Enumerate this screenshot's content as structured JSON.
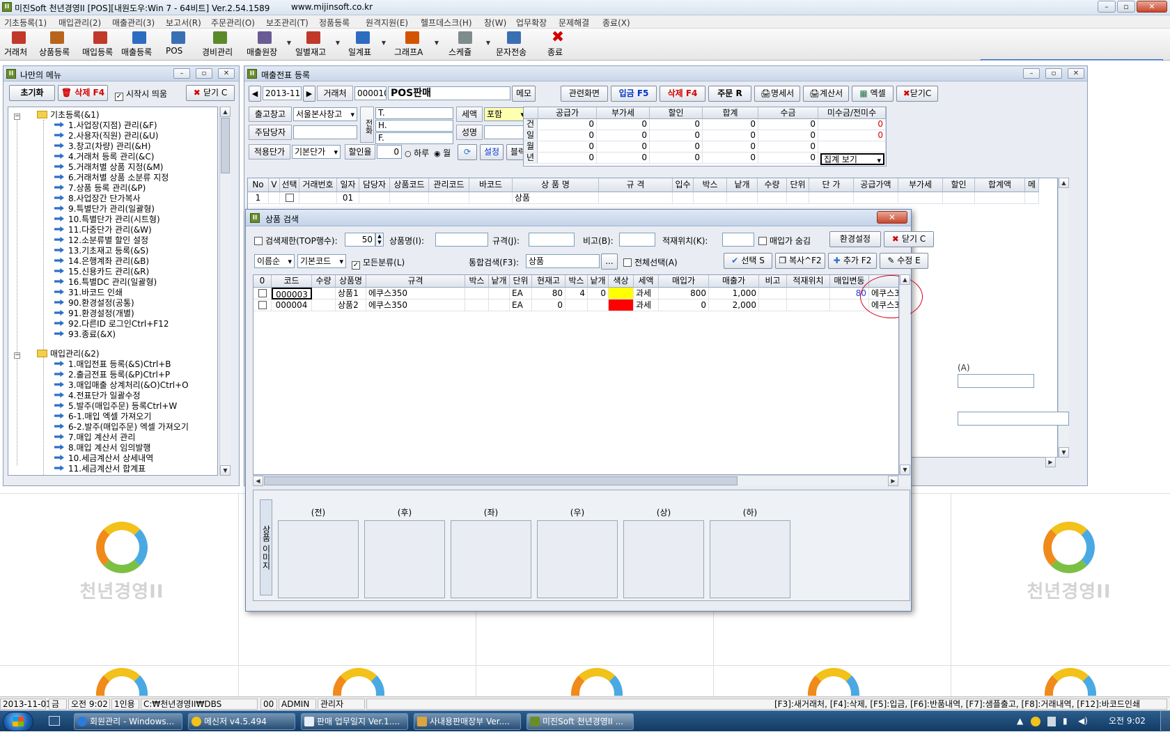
{
  "window": {
    "title": "미진Soft 천년경영II [POS][내원도우:Win 7 - 64비트] Ver.2.54.1589",
    "url": "www.mijinsoft.co.kr",
    "minimize": "–",
    "restore": "▫",
    "close": "✕"
  },
  "menu": [
    "기초등록(1)",
    "매입관리(2)",
    "매출관리(3)",
    "보고서(R)",
    "주문관리(O)",
    "보조관리(T)",
    "정품등록",
    "원격지원(E)",
    "헬프데스크(H)",
    "창(W)",
    "업무확장",
    "문제해결",
    "종료(X)"
  ],
  "toolbar": [
    {
      "label": "거래처",
      "icon": "client-icon",
      "color": "#c0392b"
    },
    {
      "label": "상품등록",
      "icon": "product-icon",
      "color": "#b8651b"
    },
    {
      "label": "매입등록",
      "icon": "purchase-icon",
      "color": "#c0392b"
    },
    {
      "label": "매출등록",
      "icon": "sales-icon",
      "color": "#2d6cc0"
    },
    {
      "label": "POS",
      "icon": "pos-icon",
      "color": "#3b6fb4"
    },
    {
      "label": "경비관리",
      "icon": "expense-icon",
      "color": "#5c8a2a"
    },
    {
      "label": "매출원장",
      "icon": "ledger-icon",
      "color": "#6b5b95"
    },
    {
      "label": "일별재고",
      "icon": "daily-stock-icon",
      "color": "#c0392b"
    },
    {
      "label": "일계표",
      "icon": "daily-report-icon",
      "color": "#2d6cc0"
    },
    {
      "label": "그래프A",
      "icon": "graph-icon",
      "color": "#d35400"
    },
    {
      "label": "스케쥴",
      "icon": "schedule-icon",
      "color": "#7f8c8d"
    },
    {
      "label": "문자전송",
      "icon": "sms-icon",
      "color": "#3b6fb4"
    },
    {
      "label": "종료",
      "icon": "exit-icon",
      "color": "#d40000"
    }
  ],
  "brand": {
    "name": "미진"
  },
  "mymenu": {
    "title": "나만의 메뉴",
    "reset": "초기화",
    "delete": "삭제 F4",
    "startup": "시작시 띄움",
    "close": "닫기 C",
    "sections": [
      {
        "label": "기초등록(&1)",
        "items": [
          "1.사업장(지점) 관리(&F)",
          "2.사용자(직원) 관리(&U)",
          "3.창고(차량) 관리(&H)",
          "4.거래처 등록 관리(&C)",
          "5.거래처별 상품 지정(&M)",
          "6.거래처별 상품 소분류 지정",
          "7.상품 등록 관리(&P)",
          "8.사업장간 단가복사",
          "9.특별단가 관리(일괄형)",
          "10.특별단가 관리(시트형)",
          "11.다중단가 관리(&W)",
          "12.소분류별 할인 설정",
          "13.기초재고 등록(&S)",
          "14.은행계좌 관리(&B)",
          "15.신용카드 관리(&R)",
          "16.특별DC 관리(일괄형)",
          "31.바코드 인쇄",
          "90.환경설정(공통)",
          "91.환경설정(개별)",
          "92.다른ID 로그인Ctrl+F12",
          "93.종료(&X)"
        ]
      },
      {
        "label": "매입관리(&2)",
        "items": [
          "1.매입전표 등록(&S)Ctrl+B",
          "2.출금전표 등록(&P)Ctrl+P",
          "3.매입매출 상계처리(&O)Ctrl+O",
          "4.전표단가 일괄수정",
          "5.발주(매입주문) 등록Ctrl+W",
          "6-1.매입 엑셀 가져오기",
          "6-2.발주(매입주문) 엑셀 가져오기",
          "7.매입 계산서 관리",
          "8.매입 계산서 임의발행",
          "10.세금계산서 상세내역",
          "11.세금계산서 합계표"
        ]
      }
    ]
  },
  "sales": {
    "title": "매출전표 등록",
    "date": "2013-11",
    "client_label": "거래처",
    "client_code": "000010",
    "client_name": "POS판매",
    "memo": "메모",
    "buttons": {
      "related": "관련화면",
      "deposit": "입금 F5",
      "delete": "삭제 F4",
      "order": "주문 R",
      "statement": "명세서",
      "invoice": "계산서",
      "excel": "엑셀",
      "close": "닫기C"
    },
    "warehouse_label": "출고창고",
    "warehouse": "서울본사창고",
    "manager_label": "주담당자",
    "phone_label": "전화",
    "phone_t": "T.",
    "phone_h": "H.",
    "phone_f": "F.",
    "tax_label": "세액",
    "tax_value": "포함",
    "name_label": "성명",
    "price_label": "적용단가",
    "price_value": "기본단가",
    "discount_label": "할인율",
    "discount_value": "0",
    "daily": "하루",
    "monthly": "월",
    "settings": "설정",
    "block": "블럭",
    "summary": {
      "headers": [
        "공급가",
        "부가세",
        "할인",
        "합계",
        "수금",
        "미수금/전미수"
      ],
      "rows": [
        {
          "label": "건",
          "values": [
            "0",
            "0",
            "0",
            "0",
            "0",
            "0"
          ]
        },
        {
          "label": "일",
          "values": [
            "0",
            "0",
            "0",
            "0",
            "0",
            "0"
          ]
        },
        {
          "label": "월",
          "values": [
            "0",
            "0",
            "0",
            "0",
            "0",
            ""
          ]
        },
        {
          "label": "년",
          "values": [
            "0",
            "0",
            "0",
            "0",
            "0",
            ""
          ]
        }
      ],
      "view": "집계 보기"
    },
    "grid": {
      "headers": [
        "No",
        "V",
        "선택",
        "거래번호",
        "일자",
        "담당자",
        "상품코드",
        "관리코드",
        "바코드",
        "상 품 명",
        "규 격",
        "입수",
        "박스",
        "낱개",
        "수량",
        "단위",
        "단 가",
        "공급가액",
        "부가세",
        "할인",
        "합계액",
        "메"
      ],
      "row": {
        "no": "1",
        "day": "01",
        "name": "상품"
      }
    },
    "side_label": "(A)"
  },
  "dialog": {
    "title": "상품 검색",
    "close": "✕",
    "limit_label": "검색제한(TOP행수):",
    "limit_value": "50",
    "name_label": "상품명(I):",
    "spec_label": "규격(J):",
    "note_label": "비고(B):",
    "location_label": "적재위치(K):",
    "hide_cost": "매입가 숨김",
    "env": "환경설정",
    "close_btn": "닫기 C",
    "sort": "이름순",
    "code_sort": "기본코드",
    "all_class": "모든분류(L)",
    "search_label": "통합검색(F3):",
    "search_value": "상품",
    "browse": "...",
    "select_all": "전체선택(A)",
    "select": "선택 S",
    "copy": "복사^F2",
    "add": "추가 F2",
    "edit": "수정 E",
    "headers": [
      "0",
      "코드",
      "수량",
      "상품명",
      "규격",
      "박스",
      "낱개",
      "단위",
      "현재고",
      "박스",
      "낱개",
      "색상",
      "세액",
      "매입가",
      "매출가",
      "비고",
      "적재위치",
      "매입변동",
      ""
    ],
    "rows": [
      {
        "code": "000003",
        "qty": "",
        "name": "상품1",
        "spec": "에쿠스350",
        "box": "",
        "each": "",
        "unit": "EA",
        "stock": "80",
        "box2": "4",
        "each2": "0",
        "color": "#ffff00",
        "tax": "과세",
        "cost": "800",
        "price": "1,000",
        "note": "",
        "loc": "",
        "change": "80",
        "extra": "에쿠스3"
      },
      {
        "code": "000004",
        "qty": "",
        "name": "상품2",
        "spec": "에쿠스350",
        "box": "",
        "each": "",
        "unit": "EA",
        "stock": "0",
        "box2": "",
        "each2": "",
        "color": "#ff0000",
        "tax": "과세",
        "cost": "0",
        "price": "2,000",
        "note": "",
        "loc": "",
        "change": "",
        "extra": "에쿠스3"
      }
    ],
    "image_section": "상품 이미지",
    "image_labels": [
      "(전)",
      "(후)",
      "(좌)",
      "(우)",
      "(상)",
      "(하)"
    ]
  },
  "bg_brand": "천년경영II",
  "statusbar": {
    "date": "2013-11-01",
    "weekday": "금",
    "time": "오전 9:02",
    "users": "1인용",
    "path": "C:₩천년경영II₩DBS",
    "code": "00",
    "user": "ADMIN",
    "role": "관리자",
    "hotkeys": "[F3]:새거래처, [F4]:삭제, [F5]:입금, [F6]:반품내역, [F7]:샘플출고, [F8]:거래내역, [F12]:바코드인쇄"
  },
  "taskbar": {
    "tasks": [
      "회원관리 - Windows...",
      "메신저 v4.5.494",
      "판매 업무일지 Ver.1....",
      "사내용판매장부 Ver....",
      "미진Soft 천년경영II ..."
    ],
    "clock": "오전 9:02"
  }
}
